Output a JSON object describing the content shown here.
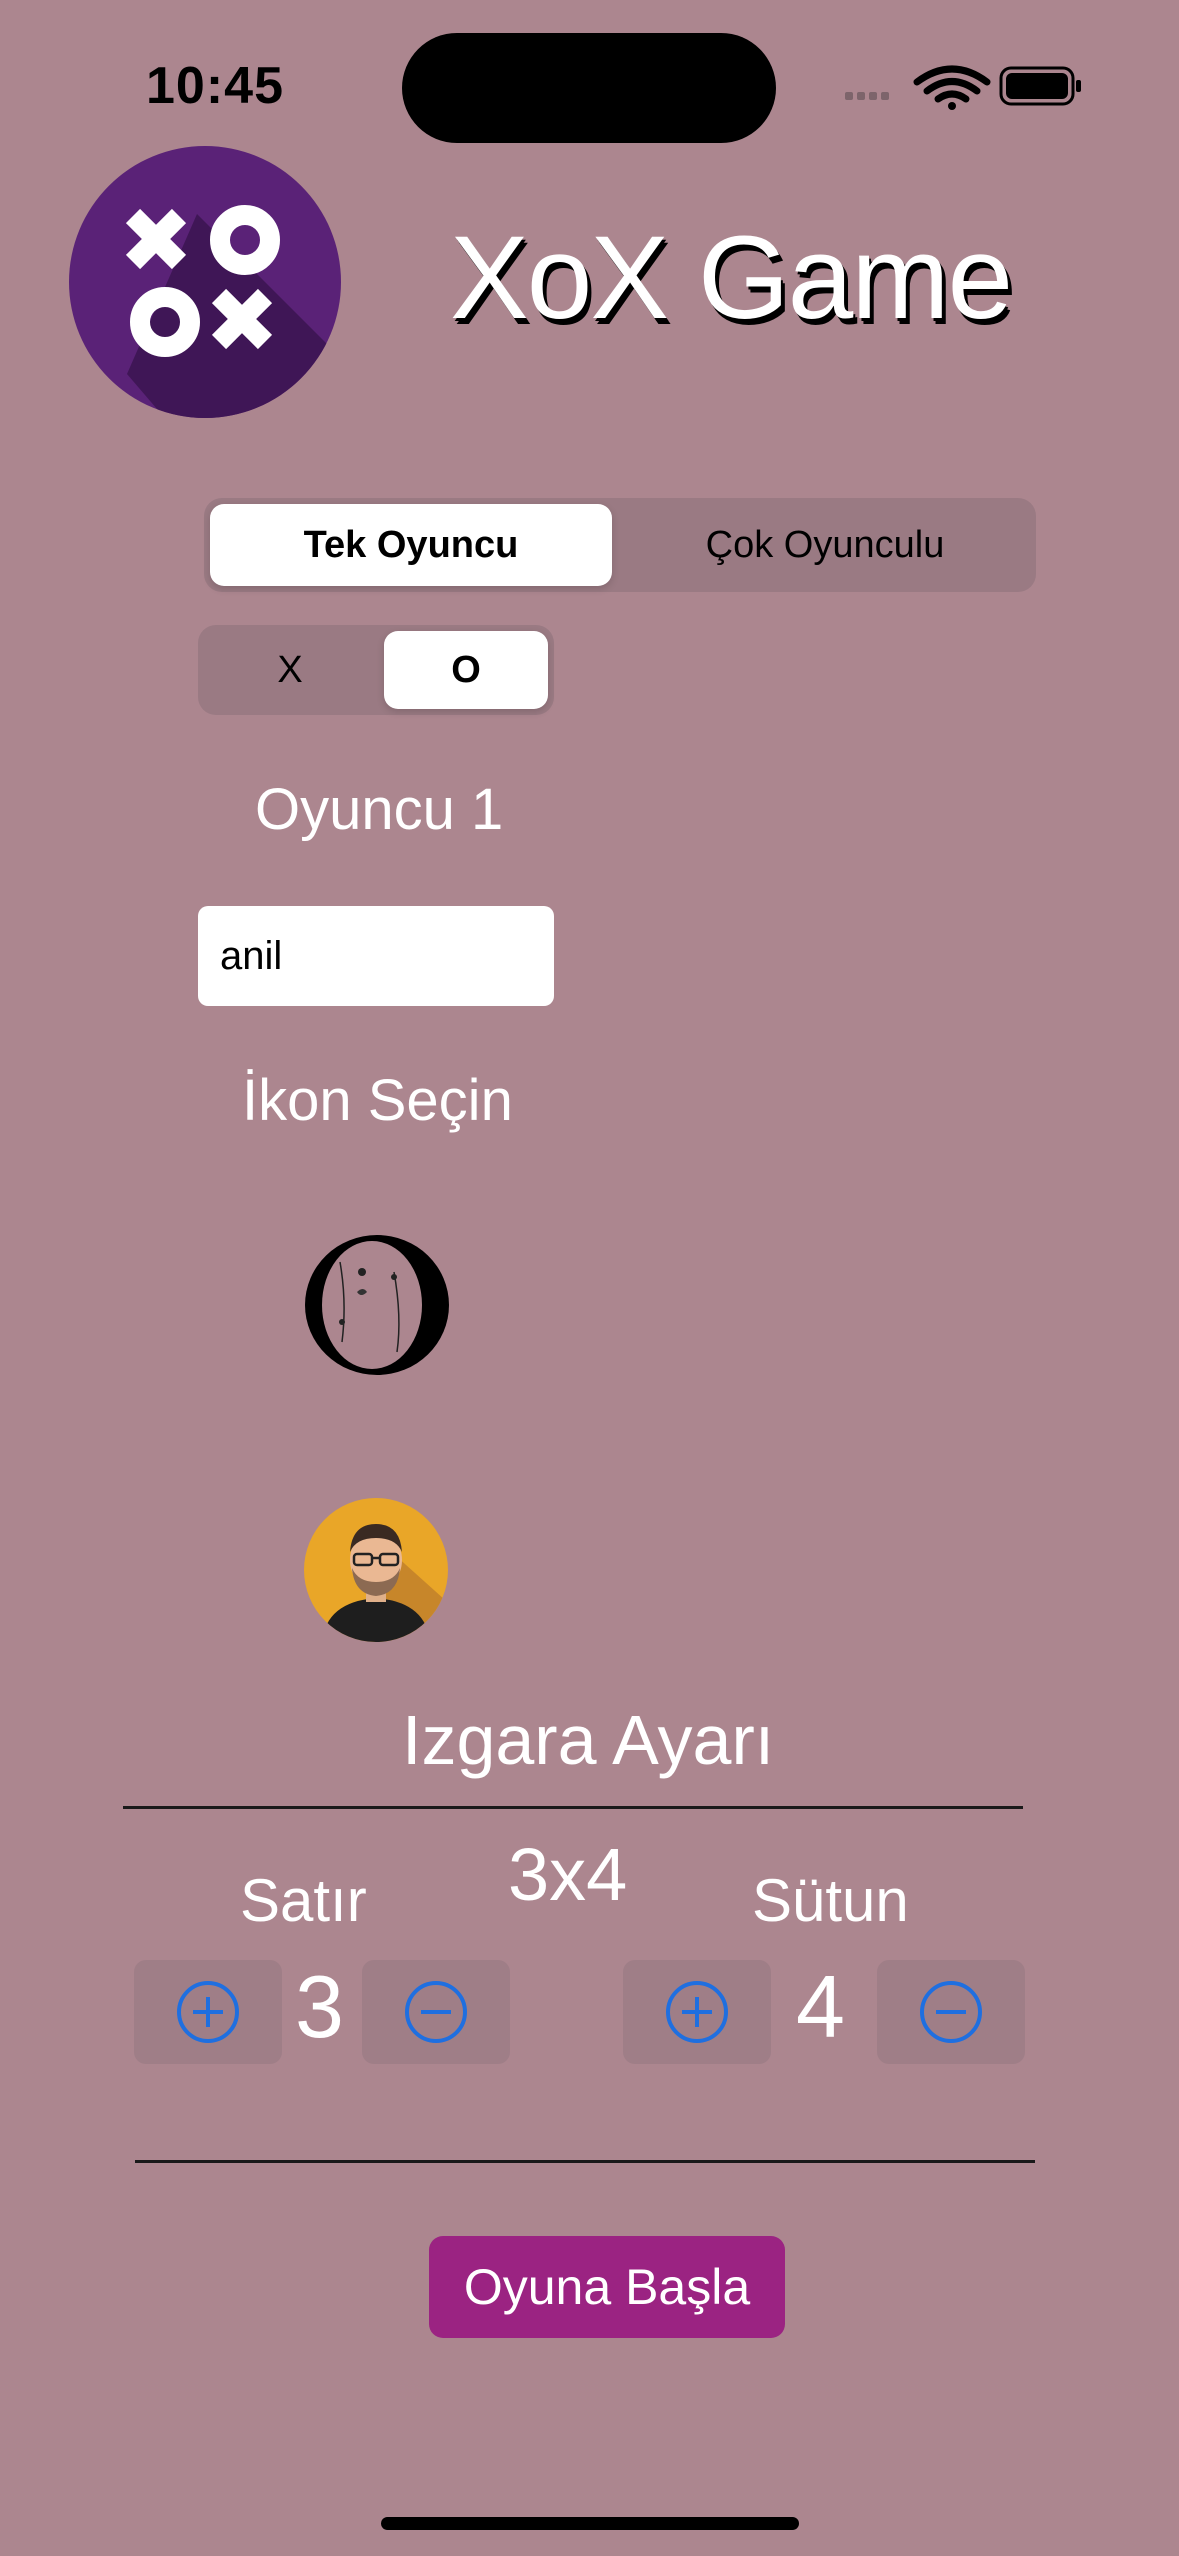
{
  "status_bar": {
    "time": "10:45",
    "wifi_icon": "wifi-icon",
    "battery_icon": "battery-icon"
  },
  "header": {
    "title": "XoX Game",
    "logo_icon": "xoxo-logo-icon"
  },
  "mode_selector": {
    "options": [
      "Tek Oyuncu",
      "Çok Oyunculu"
    ],
    "selected": "Tek Oyuncu"
  },
  "symbol_selector": {
    "options": [
      "X",
      "O"
    ],
    "selected": "O"
  },
  "player": {
    "label": "Oyuncu 1",
    "name_value": "anil"
  },
  "icon_picker": {
    "label": "İkon Seçin",
    "icons": [
      "floral-o-icon",
      "avatar-man-icon"
    ]
  },
  "grid_settings": {
    "title": "Izgara Ayarı",
    "value": "3x4",
    "rows": {
      "label": "Satır",
      "value": "3"
    },
    "columns": {
      "label": "Sütun",
      "value": "4"
    }
  },
  "actions": {
    "start_label": "Oyuna Başla"
  },
  "colors": {
    "background": "#ac868f",
    "accent": "#9b2382",
    "stepper_icon": "#1f6fe0"
  }
}
